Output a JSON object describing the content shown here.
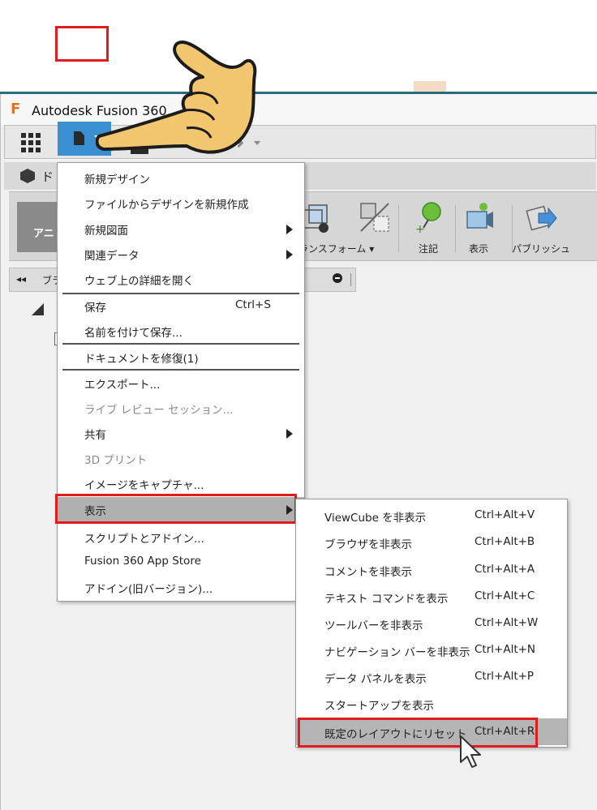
{
  "app": {
    "title": "Autodesk Fusion 360",
    "logo": "F"
  },
  "doc_tab": {
    "label": "ド"
  },
  "toolbar": {
    "workspace": "アニ",
    "tools": [
      {
        "label": "トランスフォーム ▾",
        "icon": "transform-icon"
      },
      {
        "label": "",
        "icon": "delete-icon"
      },
      {
        "label": "注記",
        "icon": "annotation-icon"
      },
      {
        "label": "表示",
        "icon": "camera-icon"
      },
      {
        "label": "パブリッシュ",
        "icon": "publish-icon"
      }
    ]
  },
  "browser": {
    "label": "ブラ"
  },
  "file_menu": {
    "items": [
      {
        "label": "新規デザイン"
      },
      {
        "label": "ファイルからデザインを新規作成"
      },
      {
        "label": "新規図面",
        "submenu": true
      },
      {
        "label": "関連データ",
        "submenu": true
      },
      {
        "label": "ウェブ上の詳細を開く"
      },
      {
        "label": "保存",
        "shortcut": "Ctrl+S"
      },
      {
        "label": "名前を付けて保存..."
      },
      {
        "label": "ドキュメントを修復(1)"
      },
      {
        "label": "エクスポート..."
      },
      {
        "label": "ライブ レビュー セッション...",
        "disabled": true
      },
      {
        "label": "共有",
        "submenu": true
      },
      {
        "label": "3D プリント",
        "disabled": true
      },
      {
        "label": "イメージをキャプチャ..."
      },
      {
        "label": "表示",
        "submenu": true,
        "highlighted": true
      },
      {
        "label": "スクリプトとアドイン..."
      },
      {
        "label": "Fusion 360 App Store"
      },
      {
        "label": "アドイン(旧バージョン)..."
      }
    ]
  },
  "display_submenu": {
    "items": [
      {
        "label": "ViewCube を非表示",
        "shortcut": "Ctrl+Alt+V"
      },
      {
        "label": "ブラウザを非表示",
        "shortcut": "Ctrl+Alt+B"
      },
      {
        "label": "コメントを非表示",
        "shortcut": "Ctrl+Alt+A"
      },
      {
        "label": "テキスト コマンドを表示",
        "shortcut": "Ctrl+Alt+C"
      },
      {
        "label": "ツールバーを非表示",
        "shortcut": "Ctrl+Alt+W"
      },
      {
        "label": "ナビゲーション バーを非表示",
        "shortcut": "Ctrl+Alt+N"
      },
      {
        "label": "データ パネルを表示",
        "shortcut": "Ctrl+Alt+P"
      },
      {
        "label": "スタートアップを表示",
        "shortcut": ""
      },
      {
        "label": "既定のレイアウトにリセット",
        "shortcut": "Ctrl+Alt+R",
        "highlighted": true
      }
    ]
  },
  "colors": {
    "highlight_box": "#e01b22",
    "file_button": "#3a8fd0",
    "menu_hover": "#b0b0b0"
  }
}
